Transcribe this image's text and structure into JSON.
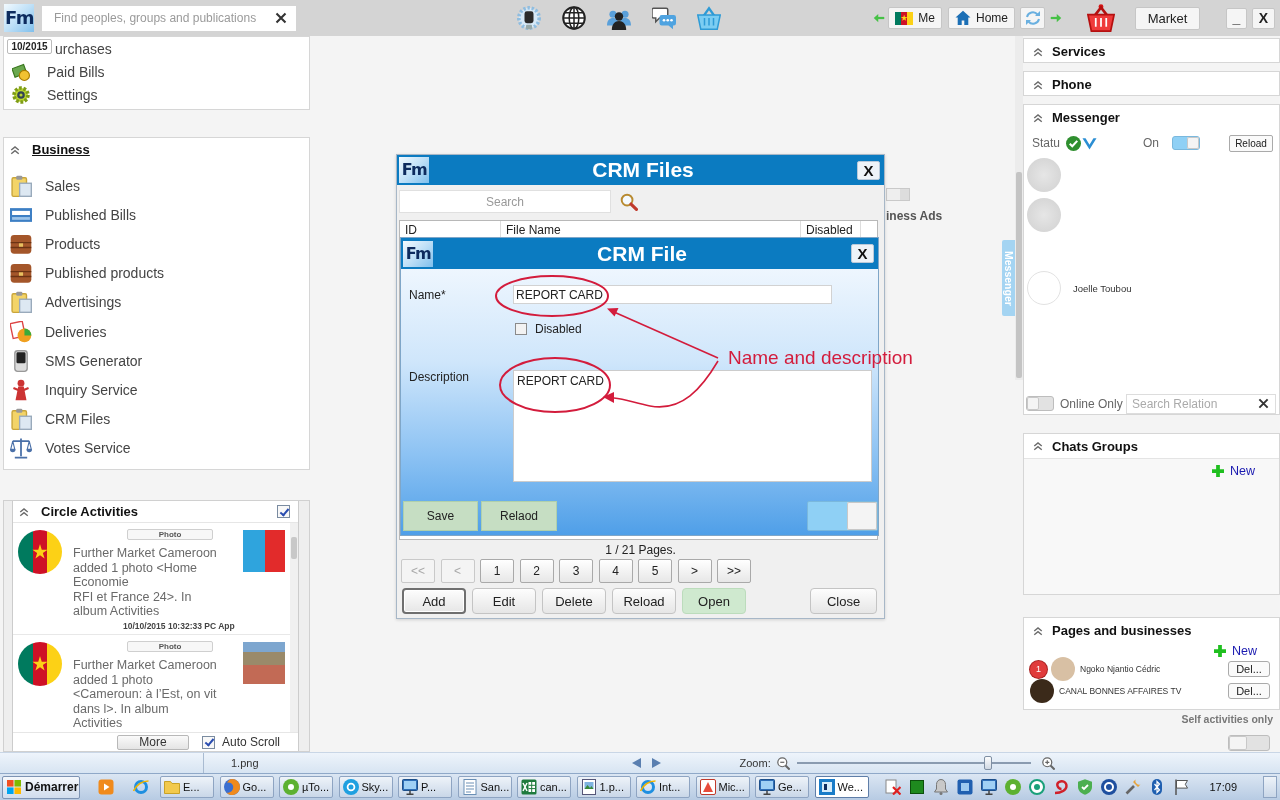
{
  "top_bar": {
    "logo": "Fm",
    "search": {
      "placeholder": "Find peoples, groups and publications"
    },
    "me_button": "Me",
    "home_button": "Home",
    "market_button": "Market",
    "window_buttons": [
      "_",
      "X"
    ]
  },
  "account_panel": {
    "date_badge": "10/2015",
    "items": [
      "urchases",
      "Paid Bills",
      "Settings"
    ]
  },
  "business_panel": {
    "title": "Business",
    "items": [
      "Sales",
      "Published Bills",
      "Products",
      "Published products",
      "Advertisings",
      "Deliveries",
      "SMS Generator",
      "Inquiry Service",
      "CRM Files",
      "Votes Service"
    ]
  },
  "circle_activities": {
    "title": "Circle Activities",
    "checked": true,
    "items": [
      {
        "tag": "Photo",
        "text": "Further Market Cameroon added 1 photo <Home Economie\nRFI et France 24>. In album Activities",
        "time": "10/10/2015 10:32:33 PC App"
      },
      {
        "tag": "Photo",
        "text": "Further Market Cameroon added 1 photo <Cameroun: à l’Est, on vit dans l>. In album Activities"
      }
    ],
    "more_button": "More",
    "auto_scroll": {
      "label": "Auto Scroll",
      "checked": true
    }
  },
  "background_panel": {
    "label": "iness Ads"
  },
  "crm_files": {
    "logo": "Fm",
    "title": "CRM Files",
    "close_button": "X",
    "search": {
      "placeholder": "Search"
    },
    "columns": [
      "ID",
      "File Name",
      "Disabled"
    ],
    "pages": "1 / 21 Pages.",
    "page_buttons": [
      {
        "label": "<<",
        "disabled": true
      },
      {
        "label": "<",
        "disabled": true
      },
      {
        "label": "1",
        "disabled": false
      },
      {
        "label": "2",
        "disabled": false
      },
      {
        "label": "3",
        "disabled": false
      },
      {
        "label": "4",
        "disabled": false
      },
      {
        "label": "5",
        "disabled": false
      },
      {
        "label": ">",
        "disabled": false
      },
      {
        "label": ">>",
        "disabled": false
      }
    ],
    "actions": [
      {
        "label": "Add",
        "kind": "focused"
      },
      {
        "label": "Edit",
        "kind": "plain"
      },
      {
        "label": "Delete",
        "kind": "plain"
      },
      {
        "label": "Reload",
        "kind": "plain"
      },
      {
        "label": "Open",
        "kind": "accent"
      }
    ],
    "close_action": "Close"
  },
  "crm_file": {
    "logo": "Fm",
    "title": "CRM File",
    "close_button": "X",
    "name": {
      "label": "Name*",
      "value": "REPORT CARD"
    },
    "disabled": {
      "label": "Disabled",
      "checked": false
    },
    "description": {
      "label": "Description",
      "value": "REPORT CARD"
    },
    "buttons": [
      "Save",
      "Relaod"
    ],
    "toggle": {
      "on": true
    }
  },
  "annotation": {
    "text": "Name and description"
  },
  "messenger_tab": "Messenger",
  "services": {
    "title": "Services"
  },
  "phone": {
    "title": "Phone"
  },
  "messenger": {
    "title": "Messenger",
    "status_label": "Statu",
    "on_label": "On",
    "on": true,
    "reload_button": "Reload",
    "contacts": [
      {
        "kind": "photo"
      },
      {
        "kind": "photo"
      },
      {
        "kind": "blank",
        "name": "Joelle Toubou"
      }
    ],
    "online_only": {
      "label": "Online Only",
      "on": false
    },
    "search": {
      "placeholder": "Search Relation"
    }
  },
  "chats_groups": {
    "title": "Chats Groups",
    "new_link": "New"
  },
  "pages": {
    "title": "Pages and businesses",
    "new_link": "New",
    "items": [
      {
        "badge": "1",
        "name": "Ngoko Njantio Cédric",
        "button": "Del..."
      },
      {
        "name": "CANAL BONNES AFFAIRES TV",
        "button": "Del..."
      }
    ]
  },
  "self_activities": {
    "label": "Self activities only",
    "on": false
  },
  "status_bar": {
    "file": "1.png",
    "zoom_label": "Zoom:",
    "zoom": {
      "level": 0.83
    }
  },
  "taskbar": {
    "start_button": "Démarrer",
    "tasks": [
      {
        "label": "E...",
        "selected": false
      },
      {
        "label": "Go...",
        "selected": false
      },
      {
        "label": "µTo...",
        "selected": false
      },
      {
        "label": "Sky...",
        "selected": false
      },
      {
        "label": "P...",
        "selected": false
      },
      {
        "label": "San...",
        "selected": false
      },
      {
        "label": "can...",
        "selected": false
      },
      {
        "label": "1.p...",
        "selected": false
      },
      {
        "label": "Int...",
        "selected": false
      },
      {
        "label": "Mic...",
        "selected": false
      },
      {
        "label": "Ge...",
        "selected": false
      },
      {
        "label": "We...",
        "selected": true
      }
    ],
    "clock": "17:09"
  }
}
